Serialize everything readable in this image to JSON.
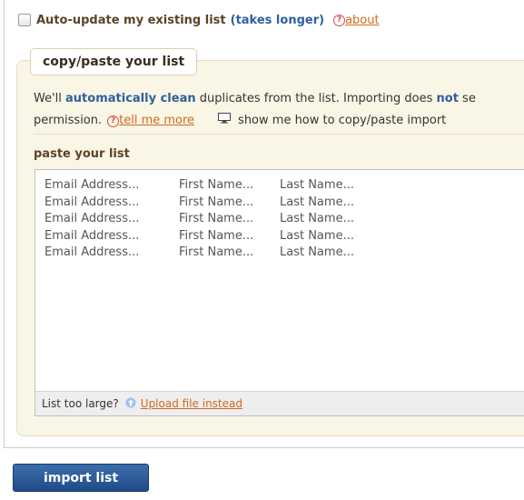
{
  "auto_update": {
    "checked": false,
    "label": "Auto-update my existing list",
    "note": "(takes longer)",
    "help_glyph": "?",
    "about_link": "about"
  },
  "panel": {
    "tab_title": "copy/paste your list",
    "description": {
      "part1": "We'll ",
      "strong1": "automatically clean",
      "part2": " duplicates from the list. Importing does ",
      "strong2": "not",
      "part3": " se",
      "line2_text": "permission.",
      "tell_me_more": "tell me more",
      "show_me_how": "show me how to copy/paste import"
    },
    "paste_label": "paste your list",
    "textarea_rows": [
      [
        "Email Address...",
        "First Name...",
        "Last Name..."
      ],
      [
        "Email Address...",
        "First Name...",
        "Last Name..."
      ],
      [
        "Email Address...",
        "First Name...",
        "Last Name..."
      ],
      [
        "Email Address...",
        "First Name...",
        "Last Name..."
      ],
      [
        "Email Address...",
        "First Name...",
        "Last Name..."
      ]
    ],
    "footer": {
      "text": "List too large?",
      "upload_link": "Upload file instead"
    }
  },
  "import_button": "import list",
  "icons": {
    "help": "help-circle-icon",
    "monitor": "monitor-icon",
    "upload": "upload-arrow-icon"
  },
  "colors": {
    "link_orange": "#d2691e",
    "accent_blue": "#2f5f9e",
    "heading_brown": "#5b4326",
    "panel_bg": "#faf6e6",
    "button_blue": "#2a5a98"
  }
}
